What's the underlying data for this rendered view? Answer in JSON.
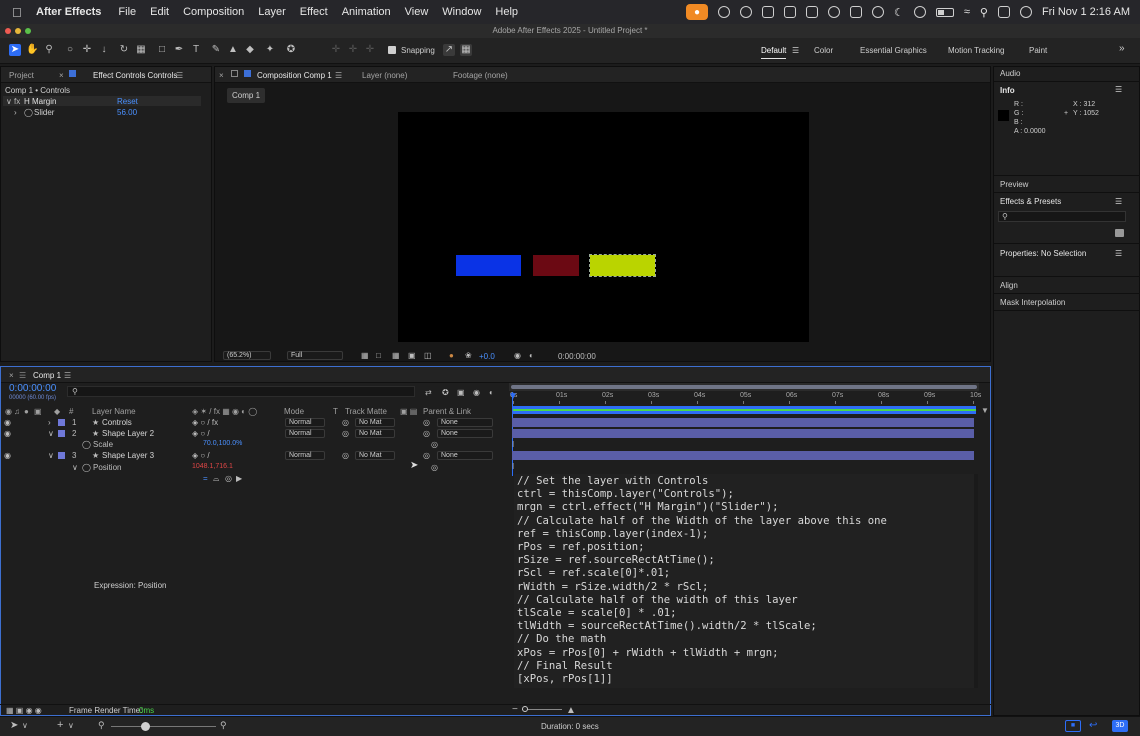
{
  "menubar": {
    "app": "After Effects",
    "items": [
      "File",
      "Edit",
      "Composition",
      "Layer",
      "Effect",
      "Animation",
      "View",
      "Window",
      "Help"
    ],
    "datetime": "Fri Nov 1  2:16 AM"
  },
  "window_title": "Adobe After Effects 2025 - Untitled Project *",
  "toolbar": {
    "snapping": "Snapping",
    "workspaces": [
      "Default",
      "Color",
      "Essential Graphics",
      "Motion Tracking",
      "Paint"
    ]
  },
  "project_panel": {
    "tab_project": "Project",
    "tab_effect": "Effect Controls Controls",
    "breadcrumb": "Comp 1 • Controls",
    "effect_name": "H Margin",
    "reset": "Reset",
    "slider_label": "Slider",
    "slider_value": "56.00"
  },
  "comp_panel": {
    "tab_comp": "Composition Comp 1",
    "tab_layer": "Layer (none)",
    "tab_footage": "Footage (none)",
    "comp_button": "Comp 1",
    "zoom": "(65.2%)",
    "resolution": "Full",
    "exposure": "+0.0",
    "timecode": "0:00:00:00",
    "rect_colors": [
      "#0a33e6",
      "#6b0913",
      "#bad400"
    ]
  },
  "right_panel": {
    "audio": "Audio",
    "info": "Info",
    "r": "R :",
    "g": "G :",
    "b": "B :",
    "a": "A : 0.0000",
    "x": "X : 312",
    "y": "Y : 1052",
    "preview": "Preview",
    "effects_presets": "Effects & Presets",
    "properties": "Properties: No Selection",
    "align": "Align",
    "mask_interp": "Mask Interpolation"
  },
  "timeline": {
    "tab": "Comp 1",
    "timecode": "0:00:00:00",
    "fps": "00000 (60.00 fps)",
    "headers": {
      "num": "#",
      "layer_name": "Layer Name",
      "mode": "Mode",
      "t": "T",
      "track_matte": "Track Matte",
      "parent": "Parent & Link"
    },
    "layers": [
      {
        "num": "1",
        "name": "Controls",
        "mode": "Normal",
        "matte": "No Mat",
        "parent": "None",
        "color": "#6f78d8"
      },
      {
        "num": "2",
        "name": "Shape Layer 2",
        "mode": "Normal",
        "matte": "No Mat",
        "parent": "None",
        "color": "#6f78d8"
      },
      {
        "num": "3",
        "name": "Shape Layer 3",
        "mode": "Normal",
        "matte": "No Mat",
        "parent": "None",
        "color": "#6f78d8"
      }
    ],
    "scale_label": "Scale",
    "scale_value": "70.0,100.0%",
    "position_label": "Position",
    "position_value": "1048.1,716.1",
    "expression_label": "Expression: Position",
    "ruler": [
      "0s",
      "01s",
      "02s",
      "03s",
      "04s",
      "05s",
      "06s",
      "07s",
      "08s",
      "09s",
      "10s"
    ],
    "code": "// Set the layer with Controls\nctrl = thisComp.layer(\"Controls\");\nmrgn = ctrl.effect(\"H Margin\")(\"Slider\");\n// Calculate half of the Width of the layer above this one\nref = thisComp.layer(index-1);\nrPos = ref.position;\nrSize = ref.sourceRectAtTime();\nrScl = ref.scale[0]*.01;\nrWidth = rSize.width/2 * rScl;\n// Calculate half of the width of this layer\ntlScale = scale[0] * .01;\ntlWidth = sourceRectAtTime().width/2 * tlScale;\n// Do the math\nxPos = rPos[0] + rWidth + tlWidth + mrgn;\n// Final Result\n[xPos, rPos[1]]",
    "frame_render_label": "Frame Render Time:",
    "frame_render_value": "0ms"
  },
  "statusbar": {
    "duration": "Duration: 0 secs"
  }
}
